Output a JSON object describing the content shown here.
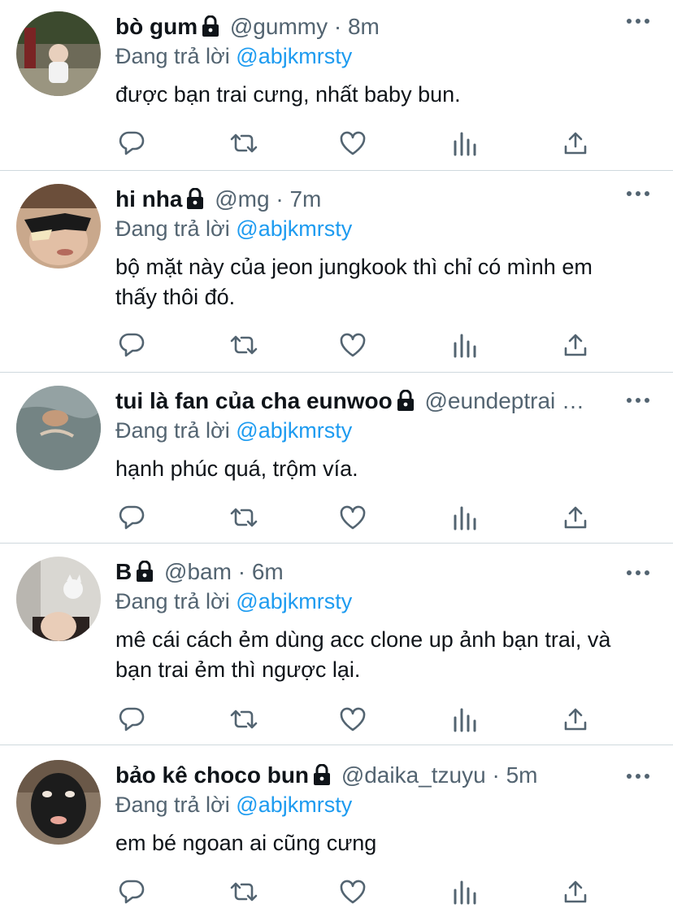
{
  "replies": [
    {
      "name": "bò gum",
      "handle": "@gummy",
      "dot": "·",
      "time": "8m",
      "replying_prefix": "Đang trả lời",
      "replying_to": "@abjkmrsty",
      "text": "được bạn trai cưng, nhất baby bun.",
      "locked": true
    },
    {
      "name": "hi nha",
      "handle": "@mg",
      "dot": "·",
      "time": "7m",
      "replying_prefix": "Đang trả lời",
      "replying_to": "@abjkmrsty",
      "text": "bộ mặt này của jeon jungkook thì chỉ có mình em thấy thôi đó.",
      "locked": true
    },
    {
      "name": "tui là fan của cha eunwoo",
      "handle": "@eundeptrai …",
      "dot": "",
      "time": "",
      "replying_prefix": "Đang trả lời",
      "replying_to": "@abjkmrsty",
      "text": "hạnh phúc quá, trộm vía.",
      "locked": true
    },
    {
      "name": "B",
      "handle": "@bam",
      "dot": "·",
      "time": "6m",
      "replying_prefix": "Đang trả lời",
      "replying_to": "@abjkmrsty",
      "text": "mê cái cách ẻm dùng acc clone up ảnh bạn trai, và bạn trai ẻm thì ngược lại.",
      "locked": true
    },
    {
      "name": "bảo kê choco bun",
      "handle": "@daika_tzuyu",
      "dot": "·",
      "time": "5m",
      "replying_prefix": "Đang trả lời",
      "replying_to": "@abjkmrsty",
      "text": "em bé ngoan ai cũng cưng",
      "locked": true
    }
  ],
  "icons": {
    "reply": "reply-icon",
    "retweet": "retweet-icon",
    "like": "like-icon",
    "stats": "stats-icon",
    "share": "share-icon",
    "more": "more-icon",
    "lock": "lock-icon"
  },
  "colors": {
    "link": "#1d9bf0",
    "secondary_text": "#536471",
    "primary_text": "#0f1419",
    "divider": "#cfd9de"
  }
}
